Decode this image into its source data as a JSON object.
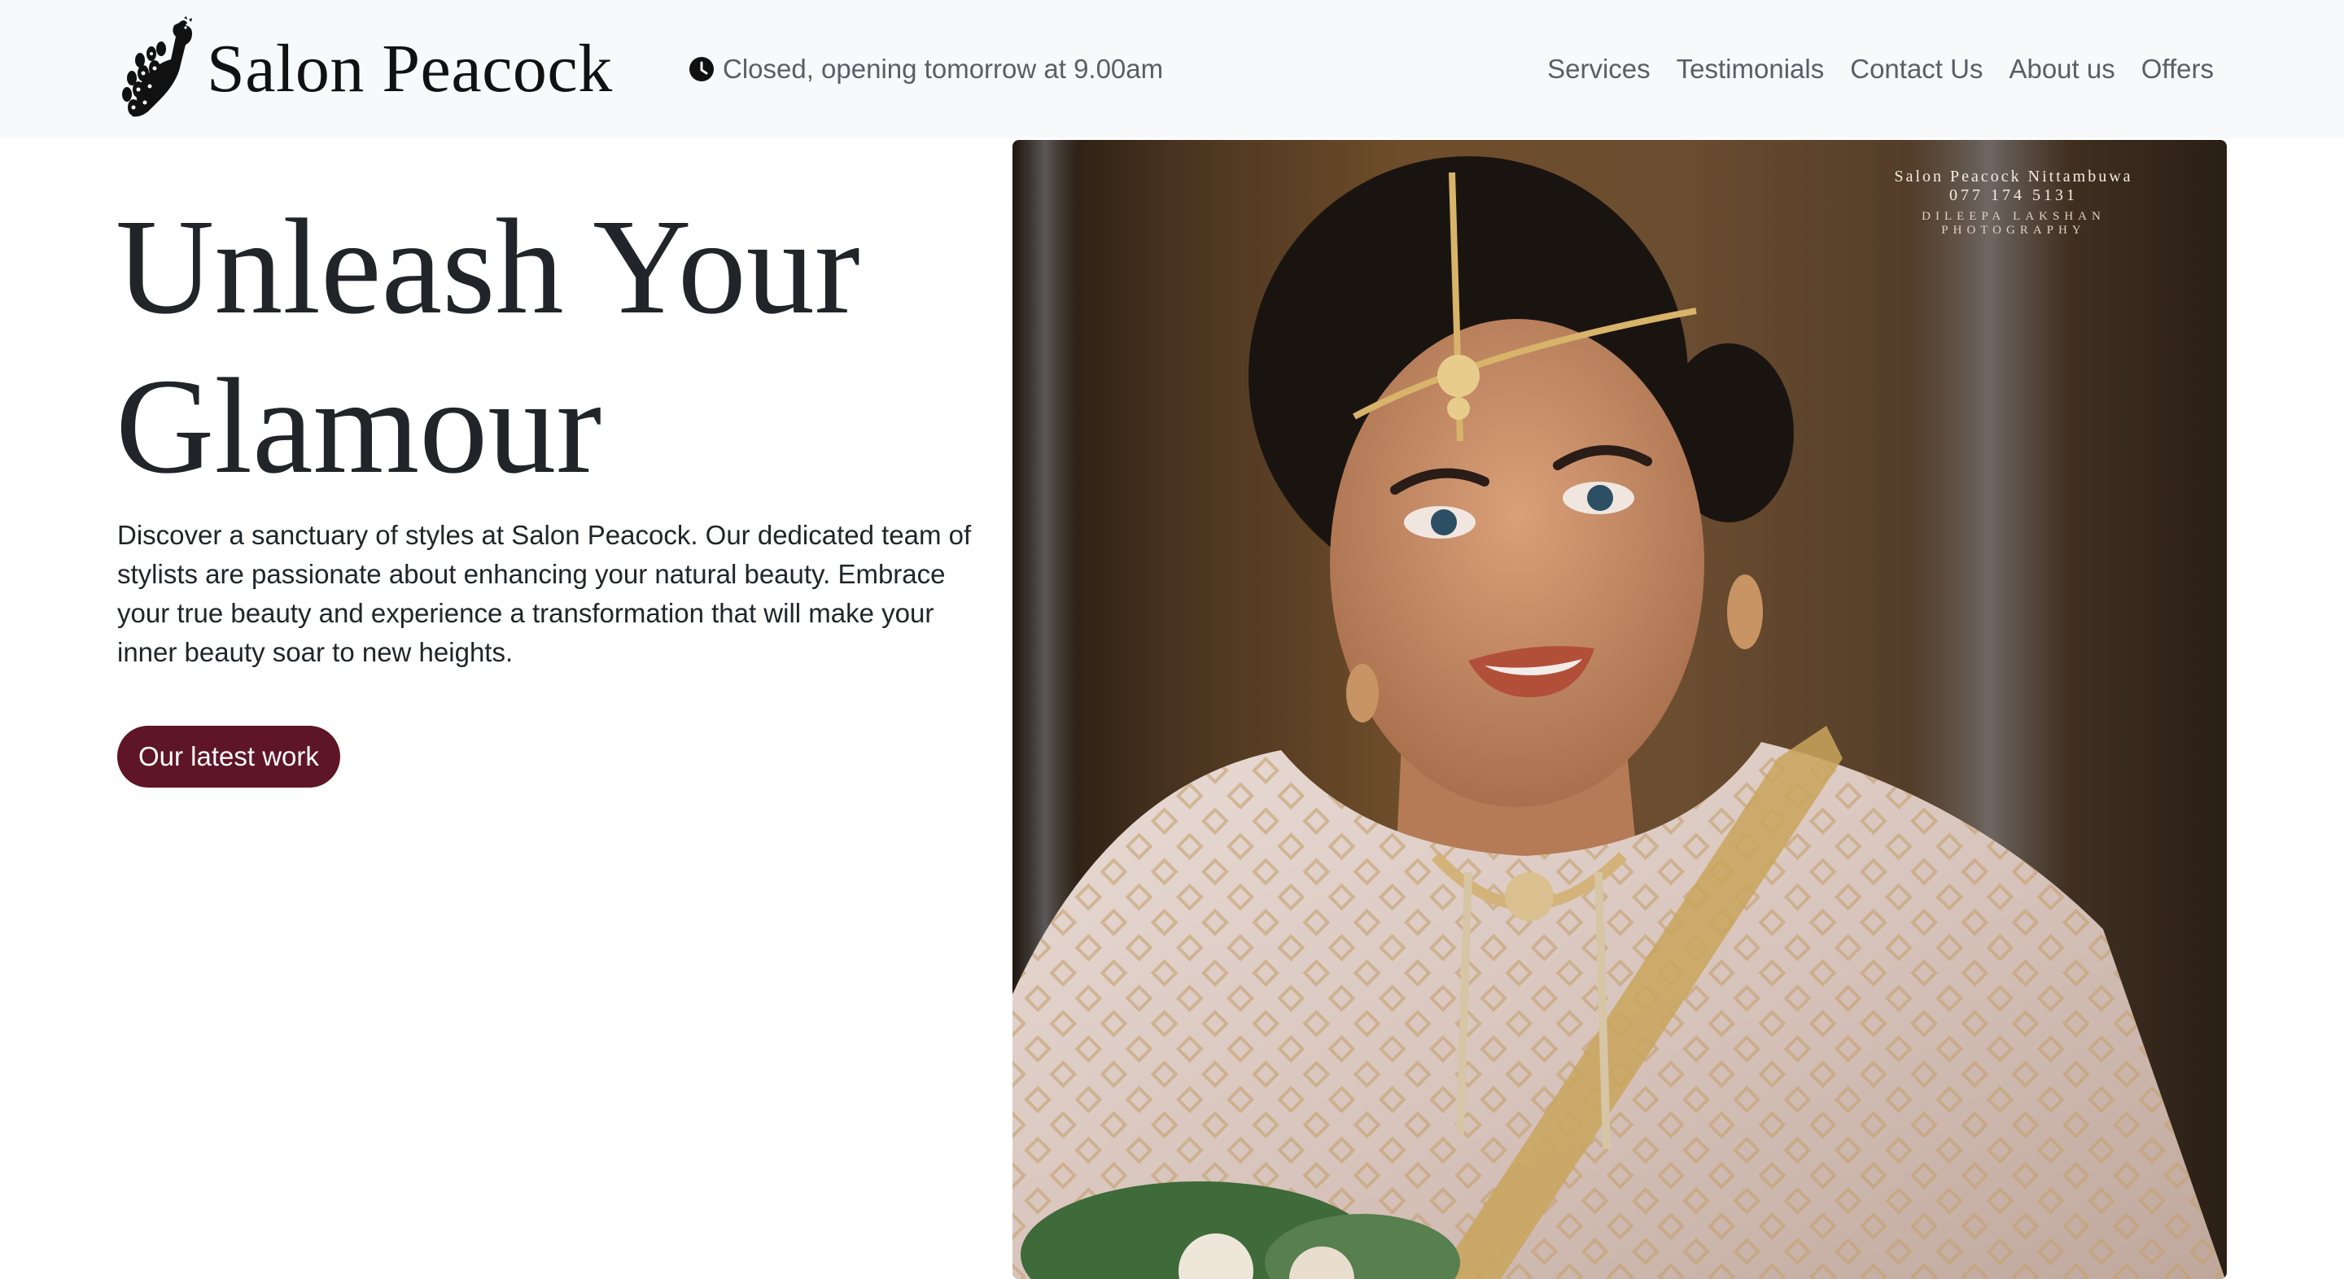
{
  "header": {
    "brand_name": "Salon Peacock",
    "status_text": "Closed, opening tomorrow at 9.00am",
    "nav": [
      "Services",
      "Testimonials",
      "Contact Us",
      "About us",
      "Offers"
    ]
  },
  "hero": {
    "title": "Unleash Your Glamour",
    "description": "Discover a sanctuary of styles at Salon Peacock. Our dedicated team of stylists are passionate about enhancing your natural beauty. Embrace your true beauty and experience a transformation that will make your inner beauty soar to new heights.",
    "cta_label": "Our latest work"
  },
  "photo": {
    "watermark": {
      "line1": "Salon Peacock Nittambuwa",
      "line2": "077 174 5131",
      "line3": "DILEEPA LAKSHAN",
      "line4": "PHOTOGRAPHY"
    }
  },
  "icons": {
    "logo": "peacock-logo-icon",
    "status": "clock-icon"
  },
  "colors": {
    "accent": "#5e1526",
    "navbar_bg": "#f8f9fa",
    "text": "#212529",
    "muted": "#5a5f66"
  }
}
